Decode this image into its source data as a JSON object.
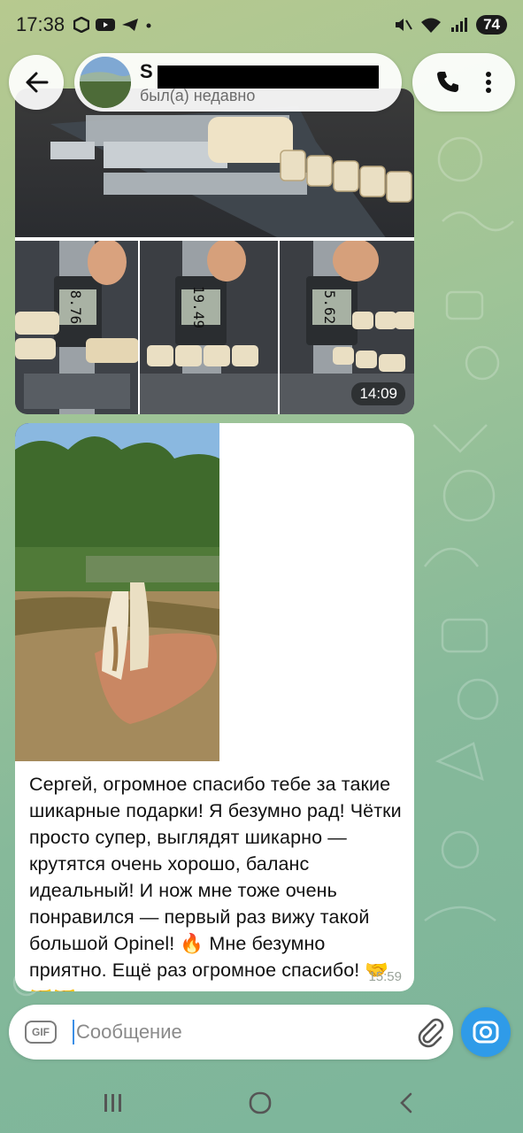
{
  "status_bar": {
    "time": "17:38",
    "battery": "74"
  },
  "header": {
    "contact_name": "S",
    "contact_status": "был(а) недавно"
  },
  "album": {
    "time": "14:09",
    "readings": [
      "8.76",
      "19.49",
      "5.62"
    ]
  },
  "message2": {
    "text": "Сергей, огромное спасибо тебе за такие шикарные подарки! Я безумно рад! Чётки просто супер, выглядят шикарно — крутятся очень хорошо, баланс идеальный! И нож мне тоже очень понравился — первый раз вижу такой большой Opinel! 🔥 Мне безумно приятно. Ещё раз огромное спасибо! 🤝🤝🤝",
    "time": "15:59"
  },
  "composer": {
    "placeholder": "Сообщение",
    "gif_label": "GIF"
  },
  "colors": {
    "accent": "#2f9be8",
    "bubble": "#ffffff"
  },
  "icons": [
    "back-arrow-icon",
    "phone-icon",
    "more-vert-icon",
    "gif-icon",
    "paperclip-icon",
    "camera-icon",
    "recents-icon",
    "home-icon",
    "back-icon"
  ]
}
